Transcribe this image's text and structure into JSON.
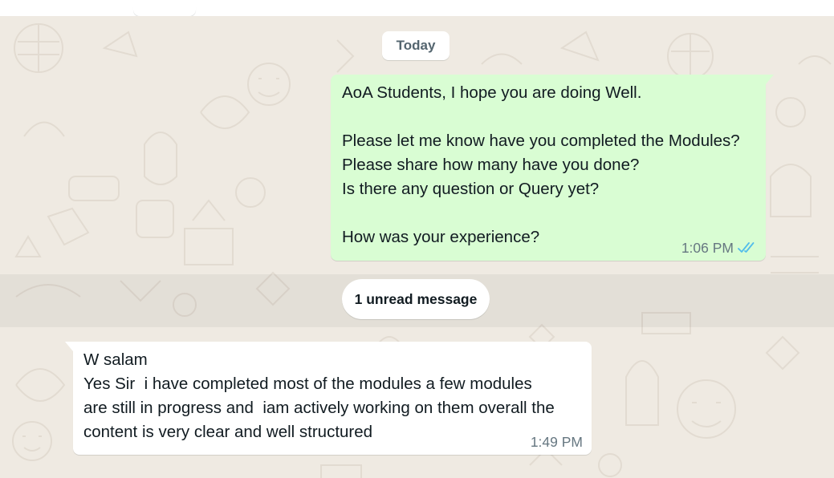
{
  "date_divider": "Today",
  "outgoing_message": {
    "lines": [
      "AoA Students, I hope you are doing Well.",
      "",
      "Please let me know have you completed the Modules?",
      "Please share how many have you done?",
      "Is there any question or Query yet?",
      "",
      "How was your experience?"
    ],
    "time": "1:06 PM",
    "status_icon": "double-check-read-icon",
    "bubble_color": "#d9fdd3",
    "tick_color": "#53bdeb"
  },
  "unread_divider": "1 unread message",
  "incoming_message": {
    "lines": [
      "W salam",
      "Yes Sir  i have completed most of the modules a few modules",
      "are still in progress and  iam actively working on them overall the",
      "content is very clear and well structured"
    ],
    "time": "1:49 PM",
    "bubble_color": "#ffffff"
  },
  "chat_background_color": "#efeae2"
}
